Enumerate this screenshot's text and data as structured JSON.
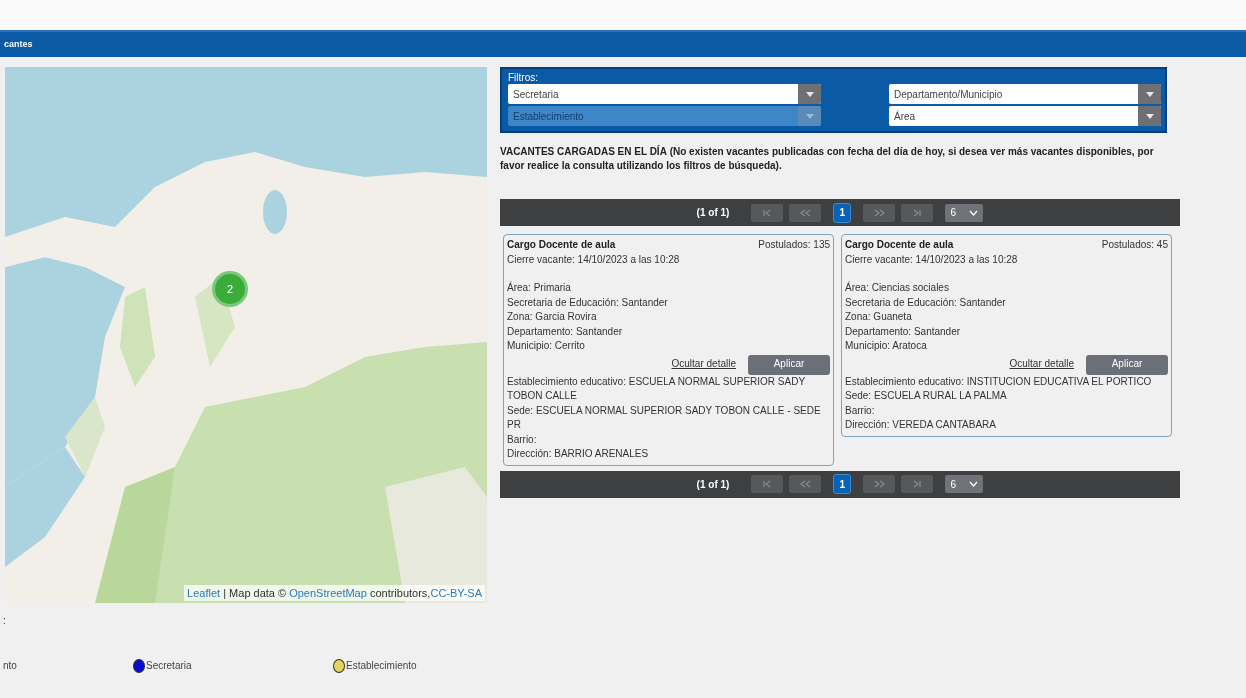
{
  "header": {
    "title": "cantes"
  },
  "map": {
    "cluster_count": "2",
    "attribution": [
      {
        "text": "Leaflet",
        "link": true
      },
      {
        "text": " | Map data © ",
        "link": false
      },
      {
        "text": "OpenStreetMap",
        "link": true
      },
      {
        "text": " contributors,",
        "link": false
      },
      {
        "text": "CC-BY-SA",
        "link": true
      }
    ]
  },
  "filters": {
    "title": "Filtros:",
    "selects": [
      {
        "placeholder": "Secretaria",
        "disabled": false
      },
      {
        "placeholder": "Departamento/Municipio",
        "disabled": false
      },
      {
        "placeholder": "Establecimiento",
        "disabled": true
      },
      {
        "placeholder": "Área",
        "disabled": false
      }
    ]
  },
  "notice": {
    "title": "VACANTES CARGADAS EN EL DÍA",
    "text": "(No existen vacantes publicadas con fecha del día de hoy, si desea ver más vacantes disponibles, por favor realice la consulta utilizando los filtros de búsqueda)."
  },
  "paginators": [
    {
      "page_info": "(1 of 1)",
      "pages": [
        {
          "label": "1",
          "selected": true
        }
      ],
      "per_page": "6"
    },
    {
      "page_info": "(1 of 1)",
      "pages": [
        {
          "label": "1",
          "selected": true
        }
      ],
      "per_page": "6"
    }
  ],
  "vacancies": [
    {
      "title": "Cargo Docente de aula",
      "applicants": "Postulados: 135",
      "closing": "Cierre vacante: 14/10/2023 a las 10:28",
      "details": [
        "Área: Primaria",
        "Secretaria de Educación: Santander",
        "Zona: Garcia Rovira",
        "Departamento: Santander",
        "Municipio: Cerrito"
      ],
      "hide_link": "Ocultar detalle",
      "apply": "Aplicar",
      "more": [
        "Establecimiento educativo: ESCUELA NORMAL SUPERIOR SADY TOBON CALLE",
        "Sede: ESCUELA NORMAL SUPERIOR SADY TOBON CALLE - SEDE PR",
        "Barrio:",
        "Dirección: BARRIO ARENALES"
      ]
    },
    {
      "title": "Cargo Docente de aula",
      "applicants": "Postulados: 45",
      "closing": "Cierre vacante: 14/10/2023 a las 10:28",
      "details": [
        "Área: Ciencias sociales",
        "Secretaria de Educación: Santander",
        "Zona: Guaneta",
        "Departamento: Santander",
        "Municipio: Aratoca"
      ],
      "hide_link": "Ocultar detalle",
      "apply": "Aplicar",
      "more": [
        "Establecimiento educativo: INSTITUCION EDUCATIVA EL PORTICO",
        "Sede: ESCUELA RURAL LA PALMA",
        "Barrio:",
        "Dirección: VEREDA CANTABARA"
      ]
    }
  ],
  "legend": {
    "title": ":",
    "items": [
      {
        "label": "nto"
      },
      {
        "label": "Secretaria",
        "color": "#0a0ad0"
      },
      {
        "label": "Establecimiento",
        "color": "#e3d35a"
      }
    ]
  }
}
